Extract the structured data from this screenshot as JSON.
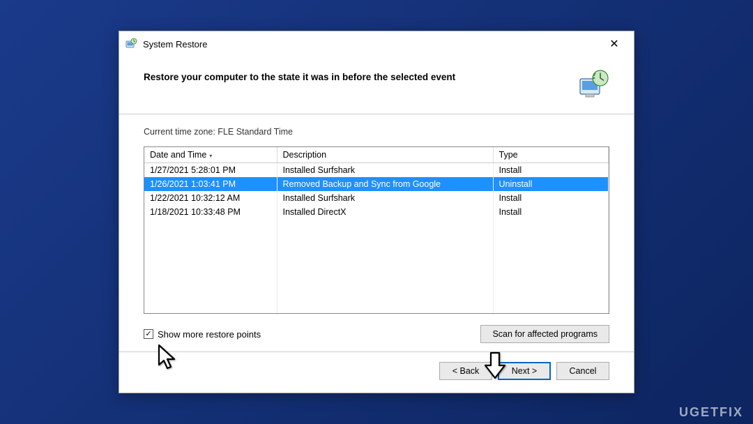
{
  "window": {
    "title": "System Restore",
    "close_glyph": "✕"
  },
  "header": {
    "heading": "Restore your computer to the state it was in before the selected event"
  },
  "timezone_label": "Current time zone: FLE Standard Time",
  "table": {
    "headers": {
      "date": "Date and Time",
      "desc": "Description",
      "type": "Type"
    },
    "rows": [
      {
        "date": "1/27/2021 5:28:01 PM",
        "desc": "Installed Surfshark",
        "type": "Install",
        "selected": false
      },
      {
        "date": "1/26/2021 1:03:41 PM",
        "desc": "Removed Backup and Sync from Google",
        "type": "Uninstall",
        "selected": true
      },
      {
        "date": "1/22/2021 10:32:12 AM",
        "desc": "Installed Surfshark",
        "type": "Install",
        "selected": false
      },
      {
        "date": "1/18/2021 10:33:48 PM",
        "desc": "Installed DirectX",
        "type": "Install",
        "selected": false
      }
    ]
  },
  "show_more": {
    "checked": true,
    "label": "Show more restore points"
  },
  "buttons": {
    "scan": "Scan for affected programs",
    "back": "< Back",
    "next": "Next >",
    "cancel": "Cancel"
  },
  "watermark": "UGETFIX"
}
